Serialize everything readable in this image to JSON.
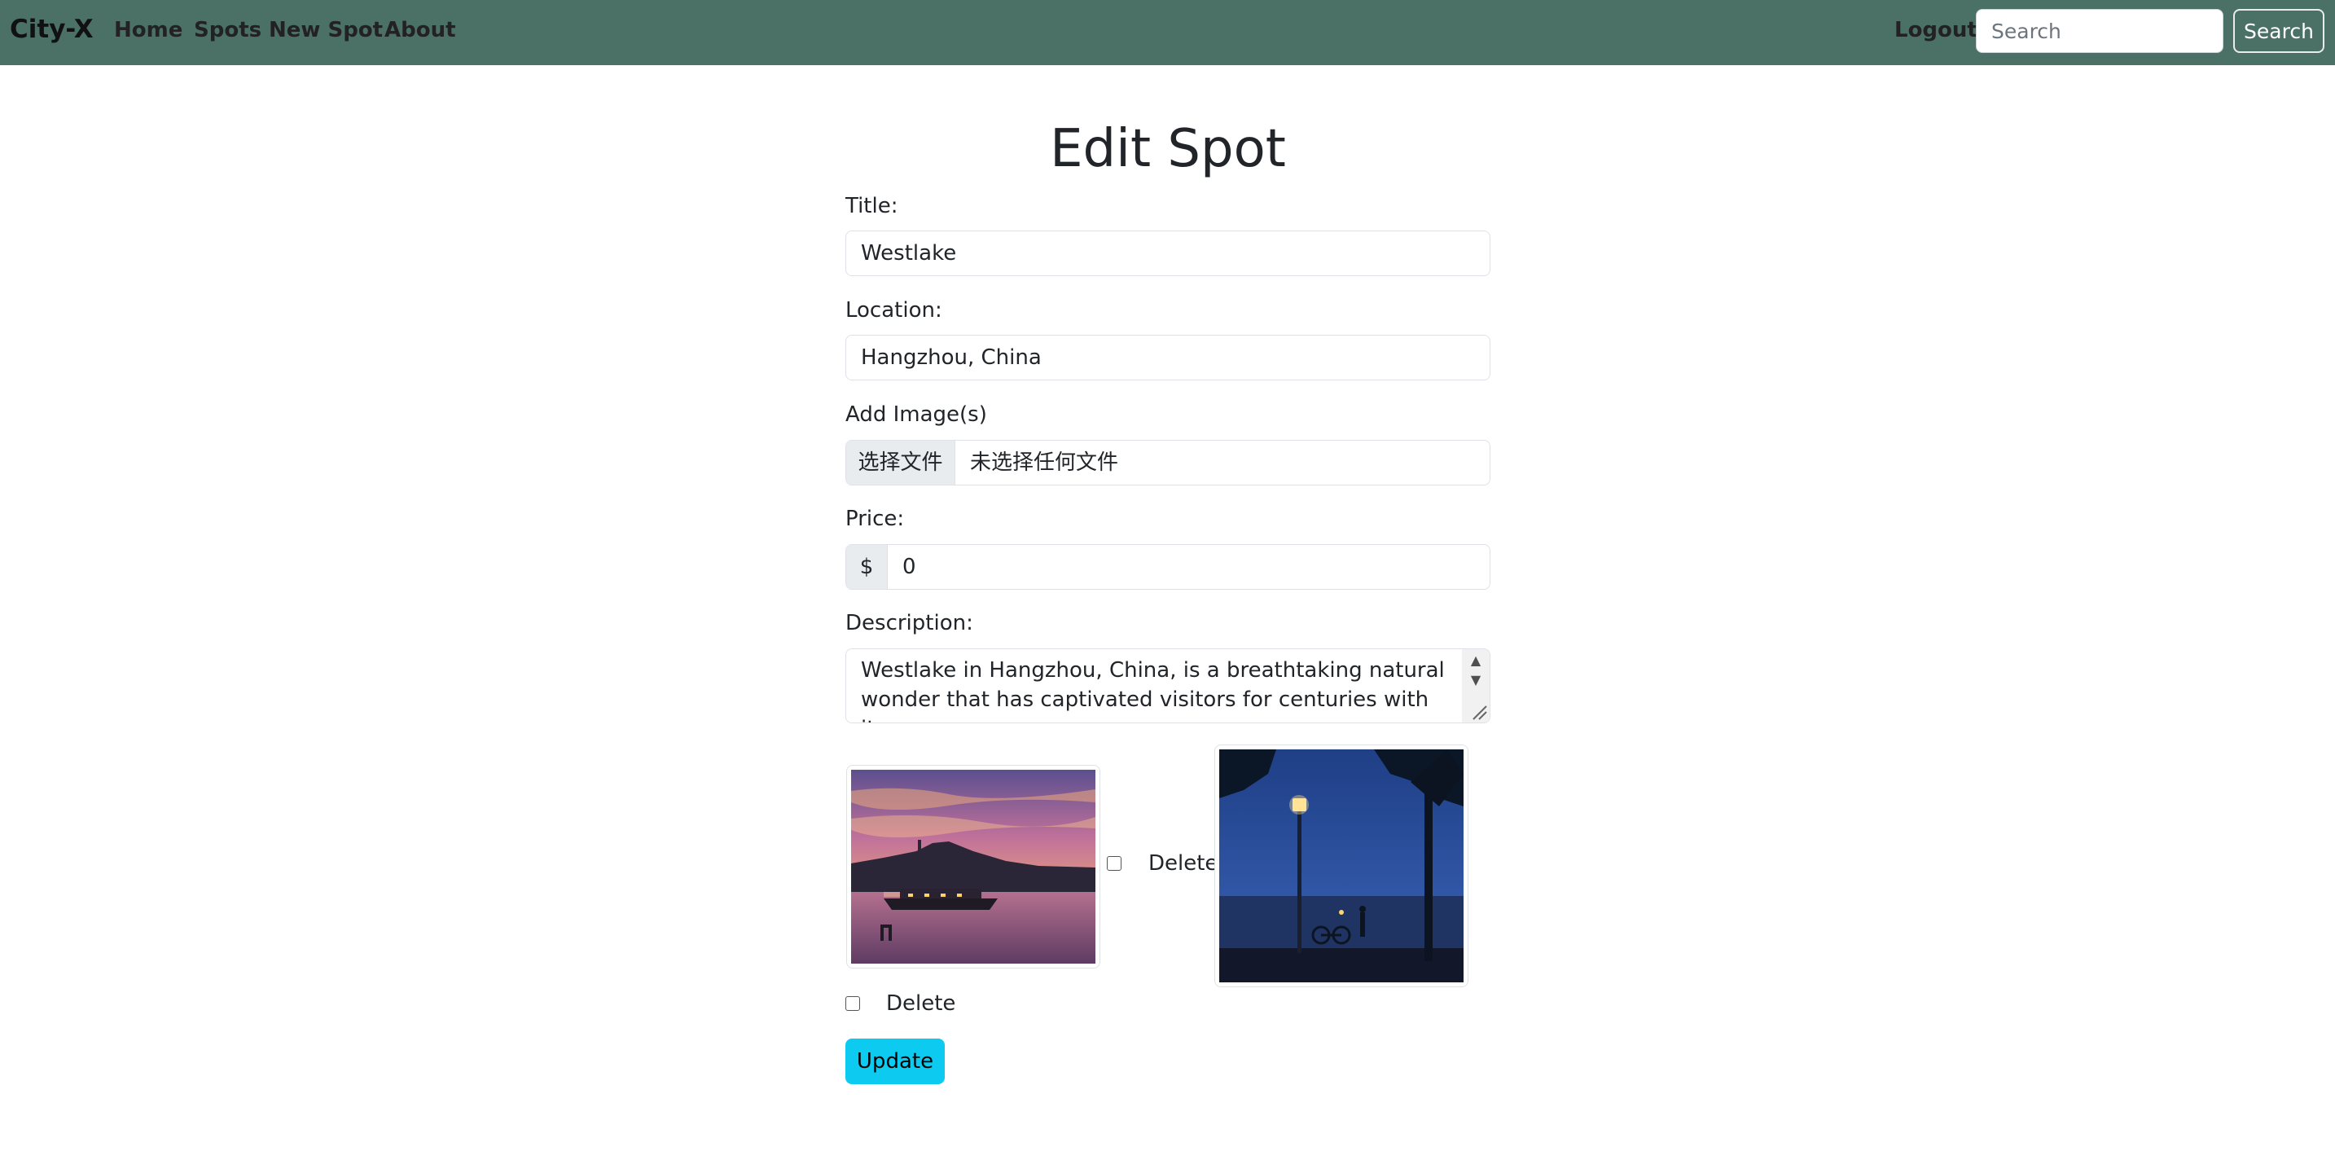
{
  "navbar": {
    "brand": "City-X",
    "links": [
      "Home",
      "Spots",
      "New Spot",
      "About"
    ],
    "logout": "Logout",
    "search_placeholder": "Search",
    "search_button": "Search",
    "background_color": "#4b7166"
  },
  "form": {
    "title": "Edit Spot",
    "title_label": "Title:",
    "title_value": "Westlake",
    "location_label": "Location:",
    "location_value": "Hangzhou, China",
    "images_label": "Add Image(s)",
    "file_button": "选择文件",
    "file_status": "未选择任何文件",
    "price_label": "Price:",
    "price_prefix": "$",
    "price_value": "0",
    "description_label": "Description:",
    "description_value": "Westlake in Hangzhou, China, is a breathtaking natural wonder that has captivated visitors for centuries with its",
    "images": [
      {
        "delete_label": "Delete",
        "icon": "sunset-boat-image"
      },
      {
        "delete_label": "Delete",
        "icon": "night-lamp-image"
      }
    ],
    "update_button": "Update",
    "update_button_color": "#0dcaf0"
  }
}
